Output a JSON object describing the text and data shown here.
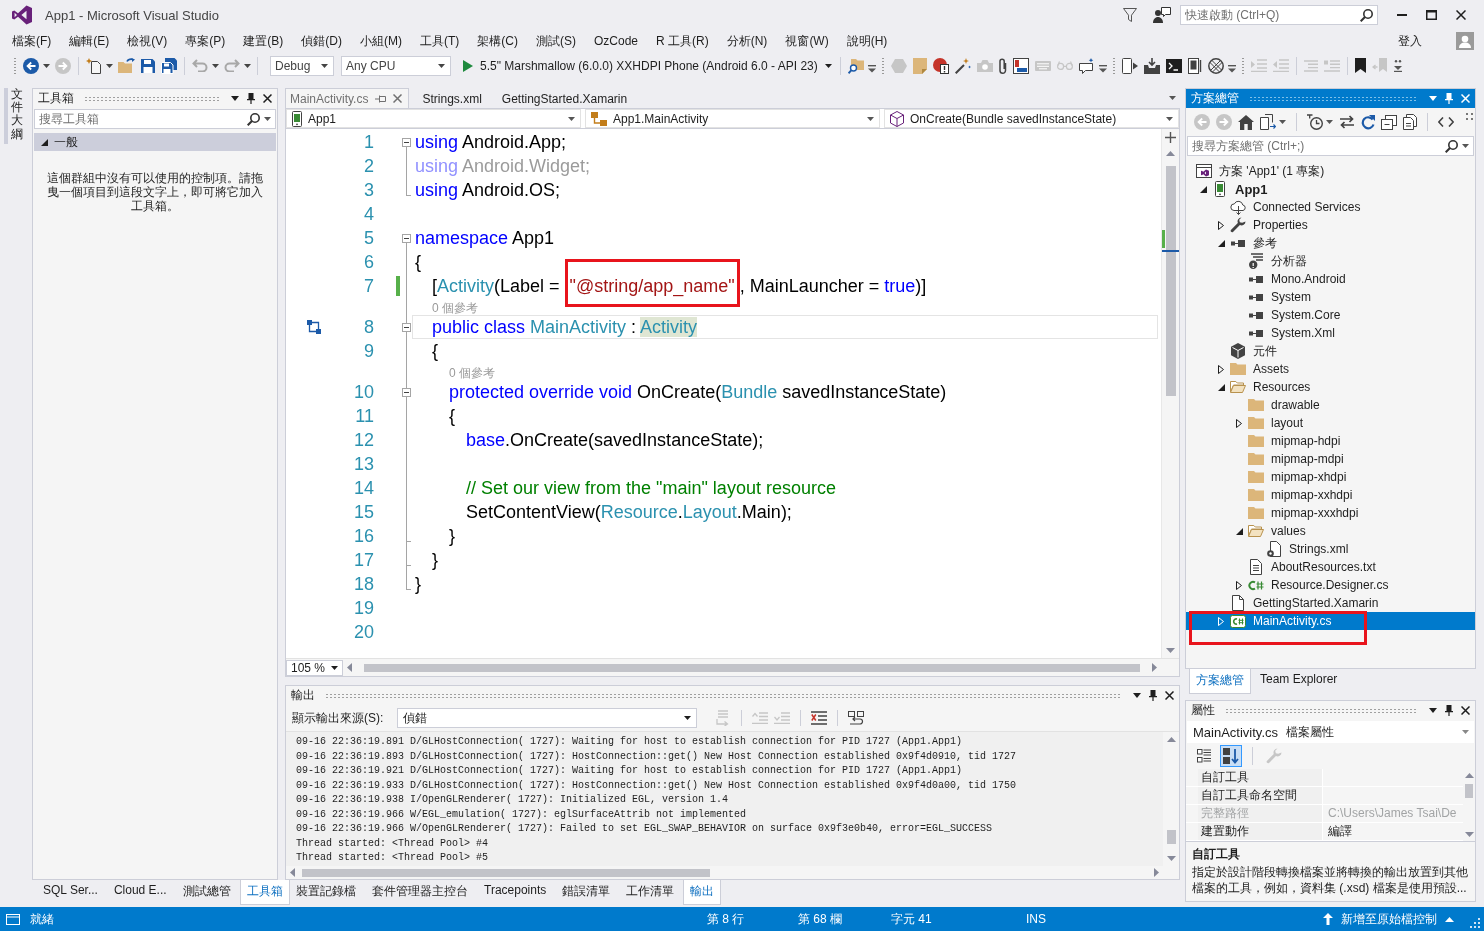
{
  "window": {
    "title": "App1 - Microsoft Visual Studio",
    "quick_launch": {
      "placeholder": "快速啟動 (Ctrl+Q)"
    },
    "sign_in": "登入"
  },
  "menu": [
    "檔案(F)",
    "編輯(E)",
    "檢視(V)",
    "專案(P)",
    "建置(B)",
    "偵錯(D)",
    "小組(M)",
    "工具(T)",
    "架構(C)",
    "測試(S)",
    "OzCode",
    "R 工具(R)",
    "分析(N)",
    "視窗(W)",
    "說明(H)"
  ],
  "toolbar": {
    "configuration": "Debug",
    "platform": "Any CPU",
    "run_target": "5.5\" Marshmallow (6.0.0) XXHDPI Phone (Android 6.0 - API 23)"
  },
  "side_tabs": [
    {
      "label": "文件大綱",
      "selected": false
    }
  ],
  "toolbox": {
    "title": "工具箱",
    "active": false,
    "search": {
      "placeholder": "搜尋工具箱"
    },
    "groups": [
      {
        "label": "一般",
        "expanded": true,
        "message": "這個群組中沒有可以使用的控制項。請拖曳一個項目到這段文字上，即可將它加入工具箱。"
      }
    ],
    "tabs": [
      {
        "label": "SQL Ser...",
        "selected": false
      },
      {
        "label": "Cloud E...",
        "selected": false
      },
      {
        "label": "測試總管",
        "selected": false
      },
      {
        "label": "工具箱",
        "selected": true
      }
    ]
  },
  "editor": {
    "tabs": [
      {
        "label": "MainActivity.cs",
        "selected": true
      },
      {
        "label": "Strings.xml",
        "selected": false
      },
      {
        "label": "GettingStarted.Xamarin",
        "selected": false
      }
    ],
    "navigation": {
      "project": "App1",
      "type": "App1.MainActivity",
      "member": "OnCreate(Bundle savedInstanceState)"
    },
    "lines": [
      {
        "number": "1",
        "collapsible": true,
        "changed": false,
        "current": false,
        "tokens": [
          {
            "text": "using",
            "kind": "keyword"
          },
          {
            "text": " Android.App;",
            "kind": "plain"
          }
        ]
      },
      {
        "number": "2",
        "changed": false,
        "current": false,
        "tokens": [
          {
            "text": "using",
            "kind": "dimkeyword"
          },
          {
            "text": " Android.Widget;",
            "kind": "dim"
          }
        ]
      },
      {
        "number": "3",
        "block_end": true,
        "changed": false,
        "current": false,
        "tokens": [
          {
            "text": "using",
            "kind": "keyword"
          },
          {
            "text": " Android.OS;",
            "kind": "plain"
          }
        ]
      },
      {
        "number": "4",
        "changed": false,
        "current": false
      },
      {
        "number": "5",
        "collapsible": true,
        "changed": false,
        "current": false,
        "tokens": [
          {
            "text": "namespace",
            "kind": "keyword"
          },
          {
            "text": " App1",
            "kind": "plain"
          }
        ]
      },
      {
        "number": "6",
        "changed": false,
        "current": false,
        "tokens": [
          {
            "text": "{",
            "kind": "plain"
          }
        ]
      },
      {
        "number": "7",
        "changed": true,
        "current": false,
        "tokens": [
          {
            "text": "    [",
            "kind": "plain"
          },
          {
            "text": "Activity",
            "kind": "type"
          },
          {
            "text": "(Label = ",
            "kind": "plain"
          },
          {
            "text": "\"@string/app_name\"",
            "kind": "string",
            "annotated": true
          },
          {
            "text": ", MainLauncher = ",
            "kind": "plain"
          },
          {
            "text": "true",
            "kind": "keyword"
          },
          {
            "text": ")]",
            "kind": "plain"
          }
        ]
      },
      {
        "number": "8",
        "collapsible": true,
        "glyph": true,
        "codelens": "0 個參考",
        "changed": false,
        "current": true,
        "tokens": [
          {
            "text": "    public class ",
            "kind": "keyword"
          },
          {
            "text": "MainActivity",
            "kind": "type"
          },
          {
            "text": " : ",
            "kind": "plain"
          },
          {
            "text": "Activity",
            "kind": "reference"
          }
        ]
      },
      {
        "number": "9",
        "changed": false,
        "current": false,
        "tokens": [
          {
            "text": "    {",
            "kind": "plain"
          }
        ]
      },
      {
        "number": "10",
        "collapsible": true,
        "codelens": "0 個參考",
        "changed": false,
        "current": false,
        "tokens": [
          {
            "text": "        protected override void",
            "kind": "keyword"
          },
          {
            "text": " OnCreate(",
            "kind": "plain"
          },
          {
            "text": "Bundle",
            "kind": "type"
          },
          {
            "text": " savedInstanceState)",
            "kind": "plain"
          }
        ]
      },
      {
        "number": "11",
        "changed": false,
        "current": false,
        "tokens": [
          {
            "text": "        {",
            "kind": "plain"
          }
        ]
      },
      {
        "number": "12",
        "changed": false,
        "current": false,
        "tokens": [
          {
            "text": "            base",
            "kind": "keyword"
          },
          {
            "text": ".OnCreate(savedInstanceState);",
            "kind": "plain"
          }
        ]
      },
      {
        "number": "13",
        "changed": false,
        "current": false
      },
      {
        "number": "14",
        "changed": false,
        "current": false,
        "tokens": [
          {
            "text": "            // Set our view from the \"main\" layout resource",
            "kind": "comment"
          }
        ]
      },
      {
        "number": "15",
        "changed": false,
        "current": false,
        "tokens": [
          {
            "text": "            SetContentView(",
            "kind": "plain"
          },
          {
            "text": "Resource",
            "kind": "type"
          },
          {
            "text": ".",
            "kind": "plain"
          },
          {
            "text": "Layout",
            "kind": "type"
          },
          {
            "text": ".Main);",
            "kind": "plain"
          }
        ]
      },
      {
        "number": "16",
        "block_end": true,
        "changed": false,
        "current": false,
        "tokens": [
          {
            "text": "        }",
            "kind": "plain"
          }
        ]
      },
      {
        "number": "17",
        "block_end": true,
        "changed": false,
        "current": false,
        "tokens": [
          {
            "text": "    }",
            "kind": "plain"
          }
        ]
      },
      {
        "number": "18",
        "block_end": true,
        "changed": false,
        "current": false,
        "tokens": [
          {
            "text": "}",
            "kind": "plain"
          }
        ]
      },
      {
        "number": "19",
        "changed": false,
        "current": false
      },
      {
        "number": "20",
        "changed": false,
        "current": false
      }
    ],
    "zoom": "105 %"
  },
  "output": {
    "title": "輸出",
    "active": false,
    "source_label": "顯示輸出來源(S):",
    "source": "偵錯",
    "lines": [
      "09-16 22:36:19.891 D/GLHostConnection( 1727): Waiting for host to establish connection for PID 1727 (App1.App1)",
      "09-16 22:36:19.893 D/GLHostConnection( 1727): HostConnection::get() New Host Connection established 0x9f4d0910, tid 1727",
      "09-16 22:36:19.921 D/GLHostConnection( 1727): Waiting for host to establish connection for PID 1727 (App1.App1)",
      "09-16 22:36:19.933 D/GLHostConnection( 1727): HostConnection::get() New Host Connection established 0x9f4d0a00, tid 1750",
      "09-16 22:36:19.938 I/OpenGLRenderer( 1727): Initialized EGL, version 1.4",
      "09-16 22:36:19.966 W/EGL_emulation( 1727): eglSurfaceAttrib not implemented",
      "09-16 22:36:19.966 W/OpenGLRenderer( 1727): Failed to set EGL_SWAP_BEHAVIOR on surface 0x9f3e0b40, error=EGL_SUCCESS",
      "Thread started: <Thread Pool> #4",
      "Thread started: <Thread Pool> #5"
    ],
    "tabs": [
      {
        "label": "裝置記錄檔",
        "selected": false
      },
      {
        "label": "套件管理器主控台",
        "selected": false
      },
      {
        "label": "Tracepoints",
        "selected": false
      },
      {
        "label": "錯誤清單",
        "selected": false
      },
      {
        "label": "工作清單",
        "selected": false
      },
      {
        "label": "輸出",
        "selected": true
      }
    ]
  },
  "solution_explorer": {
    "title": "方案總管",
    "active": true,
    "search": {
      "placeholder": "搜尋方案總管 (Ctrl+;)"
    },
    "tree": [
      {
        "label": "方案 'App1' (1 專案)",
        "kind": "solution",
        "selected": false,
        "children": [
          {
            "label": "App1",
            "kind": "project",
            "expanded": true,
            "selected": false,
            "children": [
              {
                "label": "Connected Services",
                "kind": "services",
                "selected": false
              },
              {
                "label": "Properties",
                "kind": "properties",
                "expanded": false,
                "selected": false
              },
              {
                "label": "參考",
                "kind": "references",
                "expanded": true,
                "selected": false,
                "children": [
                  {
                    "label": "分析器",
                    "kind": "analyzers",
                    "selected": false
                  },
                  {
                    "label": "Mono.Android",
                    "kind": "assembly",
                    "selected": false
                  },
                  {
                    "label": "System",
                    "kind": "assembly",
                    "selected": false
                  },
                  {
                    "label": "System.Core",
                    "kind": "assembly",
                    "selected": false
                  },
                  {
                    "label": "System.Xml",
                    "kind": "assembly",
                    "selected": false
                  }
                ]
              },
              {
                "label": "元件",
                "kind": "components",
                "selected": false
              },
              {
                "label": "Assets",
                "kind": "folder",
                "expanded": false,
                "selected": false
              },
              {
                "label": "Resources",
                "kind": "folder",
                "expanded": true,
                "selected": false,
                "children": [
                  {
                    "label": "drawable",
                    "kind": "folder",
                    "selected": false
                  },
                  {
                    "label": "layout",
                    "kind": "folder",
                    "expanded": false,
                    "selected": false
                  },
                  {
                    "label": "mipmap-hdpi",
                    "kind": "folder",
                    "selected": false
                  },
                  {
                    "label": "mipmap-mdpi",
                    "kind": "folder",
                    "selected": false
                  },
                  {
                    "label": "mipmap-xhdpi",
                    "kind": "folder",
                    "selected": false
                  },
                  {
                    "label": "mipmap-xxhdpi",
                    "kind": "folder",
                    "selected": false
                  },
                  {
                    "label": "mipmap-xxxhdpi",
                    "kind": "folder",
                    "selected": false
                  },
                  {
                    "label": "values",
                    "kind": "folder",
                    "expanded": true,
                    "selected": false,
                    "children": [
                      {
                        "label": "Strings.xml",
                        "kind": "xml",
                        "selected": false
                      }
                    ]
                  },
                  {
                    "label": "AboutResources.txt",
                    "kind": "text",
                    "selected": false
                  },
                  {
                    "label": "Resource.Designer.cs",
                    "kind": "csharp",
                    "expanded": false,
                    "selected": false
                  }
                ]
              },
              {
                "label": "GettingStarted.Xamarin",
                "kind": "file",
                "selected": false
              },
              {
                "label": "MainActivity.cs",
                "kind": "csharpclass",
                "expanded": false,
                "selected": true,
                "annotated": true
              }
            ]
          }
        ]
      }
    ],
    "tabs": [
      {
        "label": "方案總管",
        "selected": true
      },
      {
        "label": "Team Explorer",
        "selected": false
      }
    ]
  },
  "properties": {
    "title": "屬性",
    "active": false,
    "object": "MainActivity.cs",
    "object_type": "檔案屬性",
    "alphabetical": true,
    "rows": [
      {
        "name": "自訂工具",
        "disabled": false
      },
      {
        "name": "自訂工具命名空間",
        "disabled": false
      },
      {
        "name": "完整路徑",
        "value": "C:\\Users\\James Tsai\\De",
        "disabled": true
      },
      {
        "name": "建置動作",
        "value": "編譯",
        "disabled": false
      }
    ],
    "description": {
      "title": "自訂工具",
      "text": "指定於設計階段轉換檔案並將轉換的輸出放置到其他檔案的工具，例如，資料集 (.xsd) 檔案是使用預設..."
    }
  },
  "status_bar": {
    "message": "就緒",
    "line": "第 8 行",
    "column": "第 68 欄",
    "char": "字元 41",
    "mode": "INS",
    "source_control": "新增至原始檔控制"
  }
}
